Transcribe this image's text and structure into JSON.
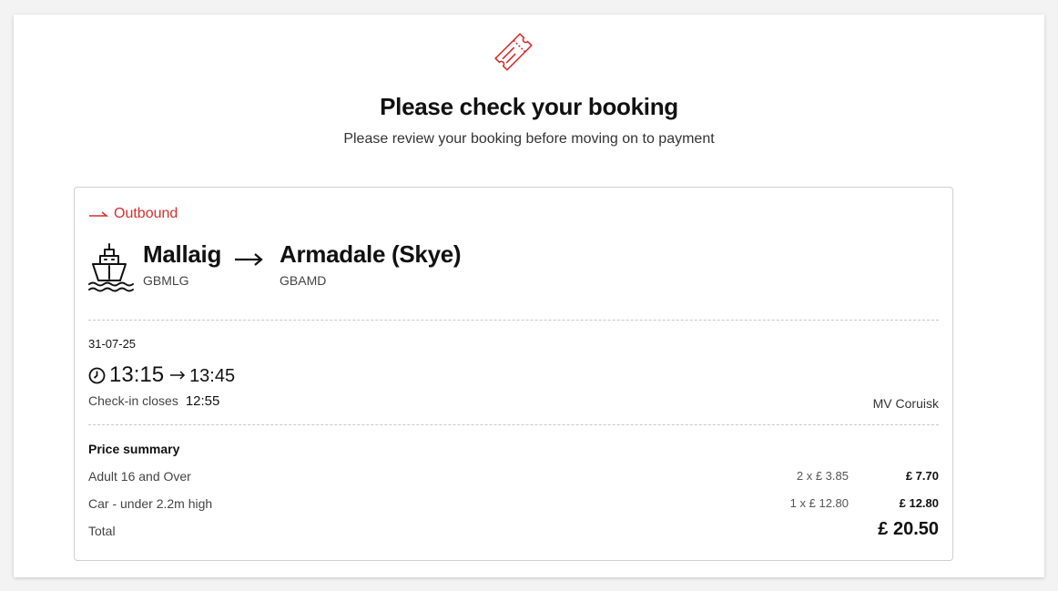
{
  "header": {
    "icon": "ticket-icon",
    "title": "Please check your booking",
    "subtitle": "Please review your booking before moving on to payment"
  },
  "colors": {
    "accent": "#d62e2e",
    "border": "#cfcfcf",
    "text": "#111111",
    "muted": "#444444"
  },
  "journey": {
    "direction_label": "Outbound",
    "direction_icon": "arrow-right-icon",
    "mode_icon": "ferry-icon",
    "from": {
      "name": "Mallaig",
      "code": "GBMLG"
    },
    "to": {
      "name": "Armadale (Skye)",
      "code": "GBAMD"
    },
    "date": "31-07-25",
    "departure": "13:15",
    "arrival": "13:45",
    "checkin_label": "Check-in closes",
    "checkin_time": "12:55",
    "vessel": "MV Coruisk"
  },
  "price_summary": {
    "heading": "Price summary",
    "items": [
      {
        "description": "Adult 16 and Over",
        "calc": "2 x £ 3.85",
        "amount": "£ 7.70"
      },
      {
        "description": "Car - under 2.2m high",
        "calc": "1 x £ 12.80",
        "amount": "£ 12.80"
      }
    ],
    "total_label": "Total",
    "total_amount": "£ 20.50"
  }
}
